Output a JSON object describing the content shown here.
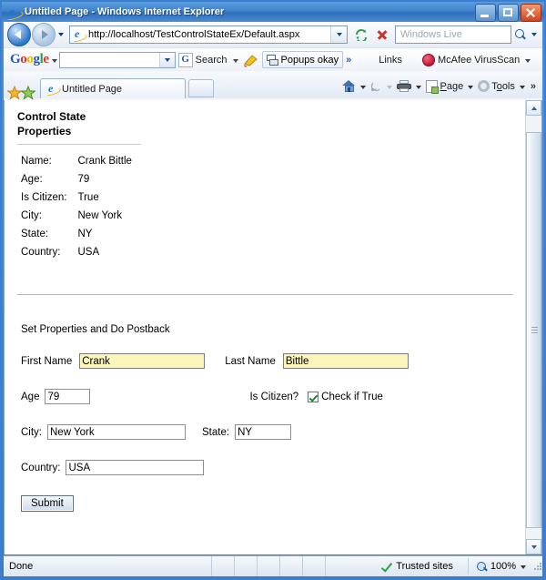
{
  "window": {
    "title": "Untitled Page - Windows Internet Explorer",
    "app_icon": "ie-logo-icon",
    "minimize_label": "Minimize",
    "maximize_label": "Maximize",
    "close_label": "Close"
  },
  "navbar": {
    "back_label": "Back",
    "forward_label": "Forward",
    "history_label": "Recent Pages",
    "address_value": "http://localhost/TestControlStateEx/Default.aspx",
    "address_placeholder": "",
    "refresh_label": "Refresh",
    "stop_label": "Stop",
    "search_placeholder": "Windows Live",
    "search_value": "",
    "search_button_label": "Search"
  },
  "google_toolbar": {
    "logo": {
      "g1": "G",
      "o1": "o",
      "o2": "o",
      "g2": "g",
      "l": "l",
      "e": "e"
    },
    "query_value": "",
    "query_placeholder": "",
    "search_label": "Search",
    "search_icon_letter": "G",
    "popups_label": "Popups okay",
    "overflow_label": "»",
    "links_label": "Links",
    "mcafee_label": "McAfee VirusScan"
  },
  "tabbar": {
    "favorites_label": "Favorites Center",
    "add_favorite_label": "Add to Favorites",
    "tab_title": "Untitled Page",
    "new_tab_label": "New Tab",
    "home_label": "Home",
    "feeds_label": "Feeds",
    "print_label": "Print",
    "page_label": "Page",
    "tools_label": "Tools",
    "overflow_label": "»"
  },
  "page": {
    "heading": "Control State Properties",
    "properties": [
      {
        "label": "Name:",
        "value": "Crank Bittle"
      },
      {
        "label": "Age:",
        "value": "79"
      },
      {
        "label": "Is Citizen:",
        "value": "True"
      },
      {
        "label": "City:",
        "value": "New York"
      },
      {
        "label": "State:",
        "value": "NY"
      },
      {
        "label": "Country:",
        "value": "USA"
      }
    ],
    "form": {
      "heading": "Set Properties and Do Postback",
      "first_name_label": "First Name",
      "first_name_value": "Crank",
      "last_name_label": "Last Name",
      "last_name_value": "Bittle",
      "age_label": "Age",
      "age_value": "79",
      "is_citizen_label": "Is Citizen?",
      "check_if_true_label": "Check if True",
      "is_citizen_checked": true,
      "city_label": "City:",
      "city_value": "New York",
      "state_label": "State:",
      "state_value": "NY",
      "country_label": "Country:",
      "country_value": "USA",
      "submit_label": "Submit"
    }
  },
  "statusbar": {
    "status_text": "Done",
    "zone_text": "Trusted sites",
    "zone_icon": "green-check-icon",
    "zoom_text": "100%",
    "zoom_icon": "magnifier-icon"
  },
  "colors": {
    "titlebar_blue": "#3e82cd",
    "autofill_yellow": "#fbf5b9",
    "check_green": "#1f8a3a",
    "google_blue": "#2d55b5",
    "google_red": "#d9352a",
    "google_yellow": "#efb600",
    "google_green": "#2e9e47"
  }
}
